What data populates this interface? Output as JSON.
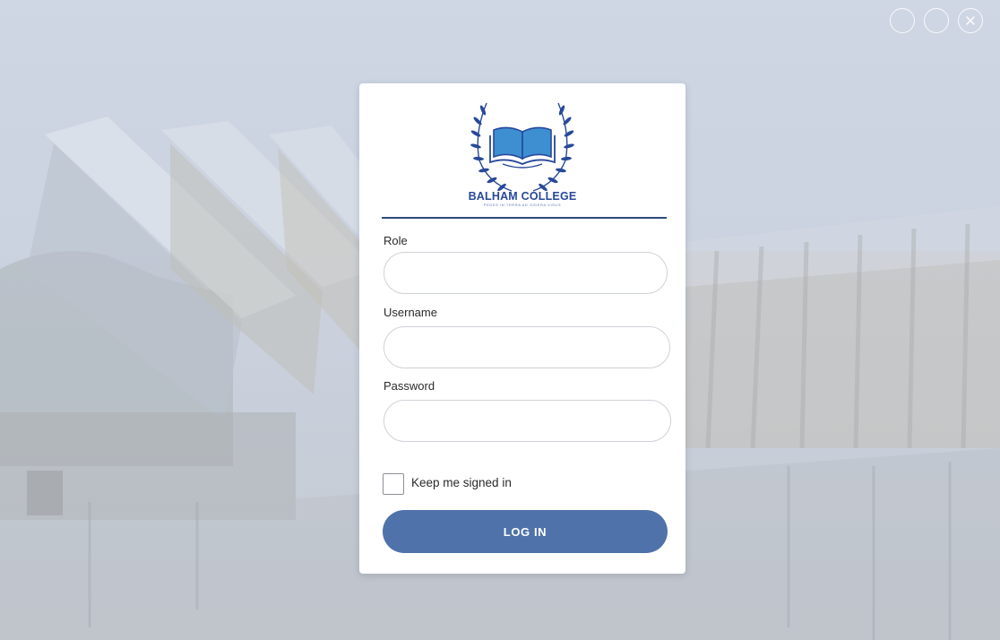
{
  "window_controls": {
    "minimize_icon": "minimize-icon",
    "maximize_icon": "maximize-icon",
    "close_icon": "close-icon"
  },
  "brand": {
    "name": "BALHAM COLLEGE",
    "motto": "PEDES IN TERRA AD SIDERA VISUS",
    "logo_icon": "open-book-laurel-icon",
    "color": "#27489a"
  },
  "form": {
    "role_label": "Role",
    "role_value": "",
    "username_label": "Username",
    "username_value": "",
    "password_label": "Password",
    "password_value": "",
    "keep_signed_in_label": "Keep me signed in",
    "keep_signed_in_checked": false,
    "login_label": "LOG IN"
  },
  "colors": {
    "accent": "#4f72aa",
    "divider": "#2d4a7a"
  }
}
